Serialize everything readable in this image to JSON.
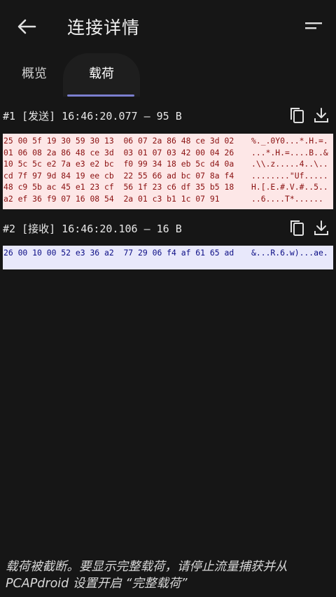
{
  "appbar": {
    "title": "连接详情"
  },
  "tabs": [
    {
      "label": "概览"
    },
    {
      "label": "载荷"
    }
  ],
  "packets": [
    {
      "header": "#1 [发送] 16:46:20.077 — 95 B",
      "direction": "sent",
      "rows": [
        {
          "hex": "25 00 5f 19 30 59 30 13  06 07 2a 86 48 ce 3d 02",
          "ascii": "%._.0Y0...*.H.=."
        },
        {
          "hex": "01 06 08 2a 86 48 ce 3d  03 01 07 03 42 00 04 26",
          "ascii": "...*.H.=....B..&"
        },
        {
          "hex": "10 5c 5c e2 7a e3 e2 bc  f0 99 34 18 eb 5c d4 0a",
          "ascii": ".\\\\.z.....4..\\.."
        },
        {
          "hex": "cd 7f 97 9d 84 19 ee cb  22 55 66 ad bc 07 8a f4",
          "ascii": "........\"Uf....."
        },
        {
          "hex": "48 c9 5b ac 45 e1 23 cf  56 1f 23 c6 df 35 b5 18",
          "ascii": "H.[.E.#.V.#..5.."
        },
        {
          "hex": "a2 ef 36 f9 07 16 08 54  2a 01 c3 b1 1c 07 91",
          "ascii": "..6....T*......"
        }
      ]
    },
    {
      "header": "#2 [接收] 16:46:20.106 — 16 B",
      "direction": "received",
      "rows": [
        {
          "hex": "26 00 10 00 52 e3 36 a2  77 29 06 f4 af 61 65 ad",
          "ascii": "&...R.6.w)...ae."
        }
      ]
    }
  ],
  "footer": {
    "notice": "载荷被截断。要显示完整载荷，请停止流量捕获并从 PCAPdroid 设置开启 “完整载荷”"
  },
  "colors": {
    "background": "#161616",
    "accent": "#7b7fcf",
    "sent_bg": "#fde7e7",
    "sent_text": "#8a1010",
    "recv_bg": "#e8e8fb",
    "recv_text": "#0c0e86"
  },
  "icons": [
    "back-arrow-icon",
    "menu-icon",
    "copy-icon",
    "download-icon"
  ]
}
